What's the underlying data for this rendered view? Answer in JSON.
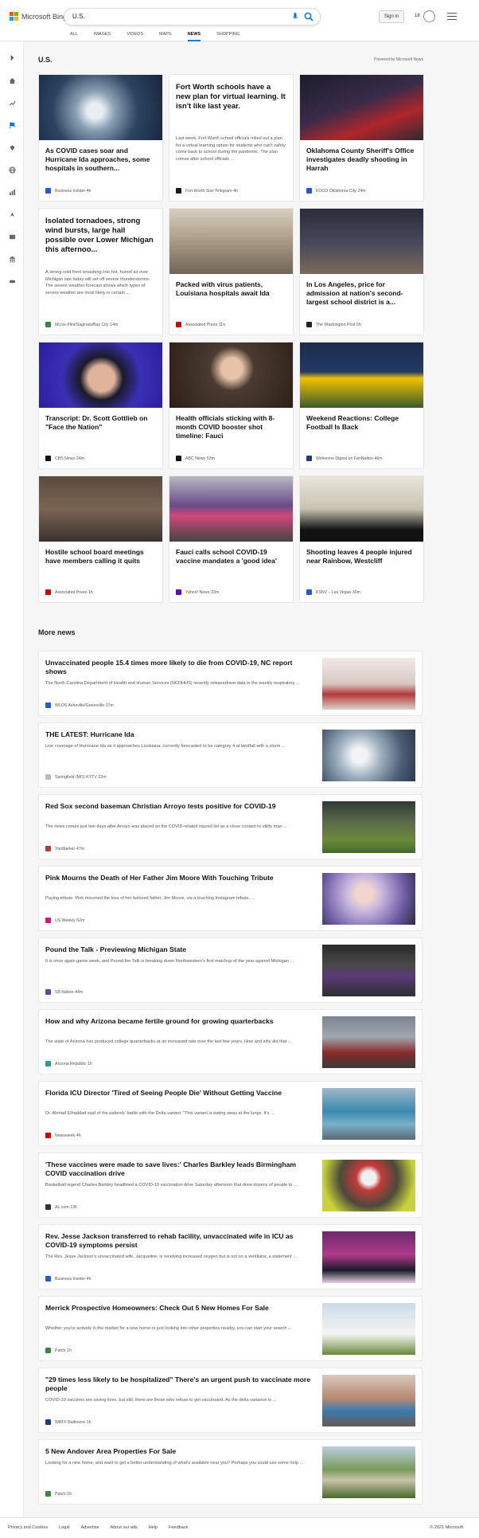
{
  "brand": {
    "name": "Microsoft Bing"
  },
  "search": {
    "query": "U.S."
  },
  "header": {
    "sign_in": "Sign in",
    "reward_count": "18"
  },
  "tabs": [
    "ALL",
    "IMAGES",
    "VIDEOS",
    "MAPS",
    "NEWS",
    "SHOPPING"
  ],
  "active_tab": "NEWS",
  "section": {
    "title": "U.S.",
    "powered_by": "Powered by Microsoft News"
  },
  "cards": [
    {
      "title": "As COVID cases soar and Hurricane Ida approaches, some hospitals in southern...",
      "source": "Business Insider",
      "time": "4h",
      "image": "hurricane-satellite",
      "badge_color": "#1e5bd8"
    },
    {
      "title": "Fort Worth schools have a new plan for virtual learning. It isn't like last year.",
      "desc": "Last week, Fort Worth school officials rolled out a plan for a virtual learning option for students who can't safely come back to school during the pandemic. The plan comes after school officials ...",
      "source": "Fort Worth Star-Telegram",
      "time": "4h",
      "image": "",
      "badge_color": "#1a1a1a"
    },
    {
      "title": "Oklahoma County Sheriff's Office investigates deadly shooting in Harrah",
      "source": "KOCO Oklahoma City",
      "time": "24m",
      "image": "police-car-night",
      "badge_color": "#1e5bd8"
    },
    {
      "title": "Isolated tornadoes, strong wind bursts, large hail possible over Lower Michigan this afternoo...",
      "desc": "A strong cold front smashing into hot, humid air over Michigan late today will set off severe thunderstorms. The severe weather forecast shows which types of severe weather are most likely in certain ...",
      "source": "MLive-Flint/Saginaw/Bay City",
      "time": "14m",
      "image": "",
      "badge_color": "#2b8a3e"
    },
    {
      "title": "Packed with virus patients, Louisiana hospitals await Ida",
      "source": "Associated Press",
      "time": "11h",
      "image": "hospital-room",
      "badge_color": "#d40000"
    },
    {
      "title": "In Los Angeles, price for admission at nation's second-largest school district is a...",
      "source": "The Washington Post",
      "time": "5h",
      "image": "school-crowd",
      "badge_color": "#222"
    },
    {
      "title": "Transcript: Dr. Scott Gottlieb on \"Face the Nation\"",
      "source": "CBS News",
      "time": "24m",
      "image": "gottlieb-portrait",
      "badge_color": "#111"
    },
    {
      "title": "Health officials sticking with 8-month COVID booster shot timeline: Fauci",
      "source": "ABC News",
      "time": "53m",
      "image": "fauci-podium",
      "badge_color": "#111"
    },
    {
      "title": "Weekend Reactions: College Football Is Back",
      "source": "Wolverine Digest on FanNation",
      "time": "46m",
      "image": "michigan-football",
      "badge_color": "#1f3a8a"
    },
    {
      "title": "Hostile school board meetings have members calling it quits",
      "source": "Associated Press",
      "time": "1h",
      "image": "board-meeting",
      "badge_color": "#d40000"
    },
    {
      "title": "Fauci calls school COVID-19 vaccine mandates a 'good idea'",
      "source": "Yahoo! News",
      "time": "33m",
      "image": "students-masks",
      "badge_color": "#6001d2"
    },
    {
      "title": "Shooting leaves 4 people injured near Rainbow, Westcliff",
      "source": "KSNV – Las Vegas",
      "time": "30m",
      "image": "police-badge",
      "badge_color": "#1e5bd8"
    }
  ],
  "more_news": {
    "title": "More news",
    "items": [
      {
        "title": "Unvaccinated people 15.4 times more likely to die from COVID-19, NC report shows",
        "desc": "The North Carolina Department of Health and Human Services (NCDHHS) recently releasednew data in the weekly respiratory ...",
        "source": "WLOS Asheville/Greenville",
        "time": "37m",
        "image": "vaccine-vials",
        "badge_color": "#1e5bd8"
      },
      {
        "title": "THE LATEST: Hurricane Ida",
        "desc": "Live coverage of Hurricane Ida as it approaches Louisiana, currently forecasted to be category 4 at landfall with a storm ...",
        "source": "Springfield (MO) KYTV",
        "time": "22m",
        "image": "hurricane-clouds",
        "badge_color": "#bbbbbb"
      },
      {
        "title": "Red Sox second baseman Christian Arroyo tests positive for COVID-19",
        "desc": "The news comes just two days after Arroyo was placed on the COVID-related injured list as a close contact to utility man ...",
        "source": "Yardbarker",
        "time": "47m",
        "image": "baseball-player",
        "badge_color": "#c0392b"
      },
      {
        "title": "Pink Mourns the Death of Her Father Jim Moore With Touching Tribute",
        "desc": "Paying tribute. Pink mourned the loss of her beloved father, Jim Moore, via a touching Instagram tribute. ...",
        "source": "US Weekly",
        "time": "52m",
        "image": "pink-portrait",
        "badge_color": "#e0127a"
      },
      {
        "title": "Pound the Talk - Previewing Michigan State",
        "desc": "It is once again game week, and Pound the Talk is breaking down Northwestern's first matchup of the year against Michigan ...",
        "source": "SB Nation",
        "time": "44m",
        "image": "football-game",
        "badge_color": "#6b3fa0"
      },
      {
        "title": "How and why Arizona became fertile ground for growing quarterbacks",
        "desc": "The state of Arizona has produced college quarterbacks at an increased rate over the last few years. How and why did that ...",
        "source": "Arizona Republic",
        "time": "1h",
        "image": "quarterback",
        "badge_color": "#2a9d8f"
      },
      {
        "title": "Florida ICU Director 'Tired of Seeing People Die' Without Getting Vaccine",
        "desc": "Dr. Ahmad Elhaddad said of the patients' battle with the Delta variant: \"This variant is eating away at the lungs. It's ...",
        "source": "Newsweek",
        "time": "4h",
        "image": "icu-staff",
        "badge_color": "#d40000"
      },
      {
        "title": "'These vaccines were made to save lives:' Charles Barkley leads Birmingham COVID vaccination drive",
        "desc": "Basketball legend Charles Barkley headlined a COVID-19 vaccination drive Saturday afternoon that drew dozens of people to ...",
        "source": "AL.com",
        "time": "13h",
        "image": "barkley-mask",
        "badge_color": "#333"
      },
      {
        "title": "Rev. Jesse Jackson transferred to rehab facility, unvaccinated wife in ICU as COVID-19 symptoms persist",
        "desc": "The Rev. Jesse Jackson's unvaccinated wife, Jacqueline, is receiving increased oxygen but is not on a ventilator, a statement ...",
        "source": "Business Insider",
        "time": "4h",
        "image": "jackson-event",
        "badge_color": "#1e5bd8"
      },
      {
        "title": "Merrick Prospective Homeowners: Check Out 5 New Homes For Sale",
        "desc": "Whether you're actively in the market for a new home or just looking into other properties nearby, you can start your search ...",
        "source": "Patch",
        "time": "1h",
        "image": "house-merrick",
        "badge_color": "#2f8f3f"
      },
      {
        "title": "\"29 times less likely to be hospitalized\" There's an urgent push to vaccinate more people",
        "desc": "COVID-19 vaccines are saving lives, but still, there are those who refuse to get vaccinated. As the delta variance is ...",
        "source": "WBFF Baltimore",
        "time": "1h",
        "image": "vaccination-shot",
        "badge_color": "#1e3a8a"
      },
      {
        "title": "5 New Andover Area Properties For Sale",
        "desc": "Looking for a new home, and want to get a better understanding of what's available near you? Perhaps you could use some help ...",
        "source": "Patch",
        "time": "1h",
        "image": "house-andover",
        "badge_color": "#2f8f3f"
      }
    ]
  },
  "footer": {
    "links": [
      "Privacy and Cookies",
      "Legal",
      "Advertise",
      "About our ads",
      "Help",
      "Feedback"
    ],
    "copyright": "© 2021 Microsoft"
  }
}
